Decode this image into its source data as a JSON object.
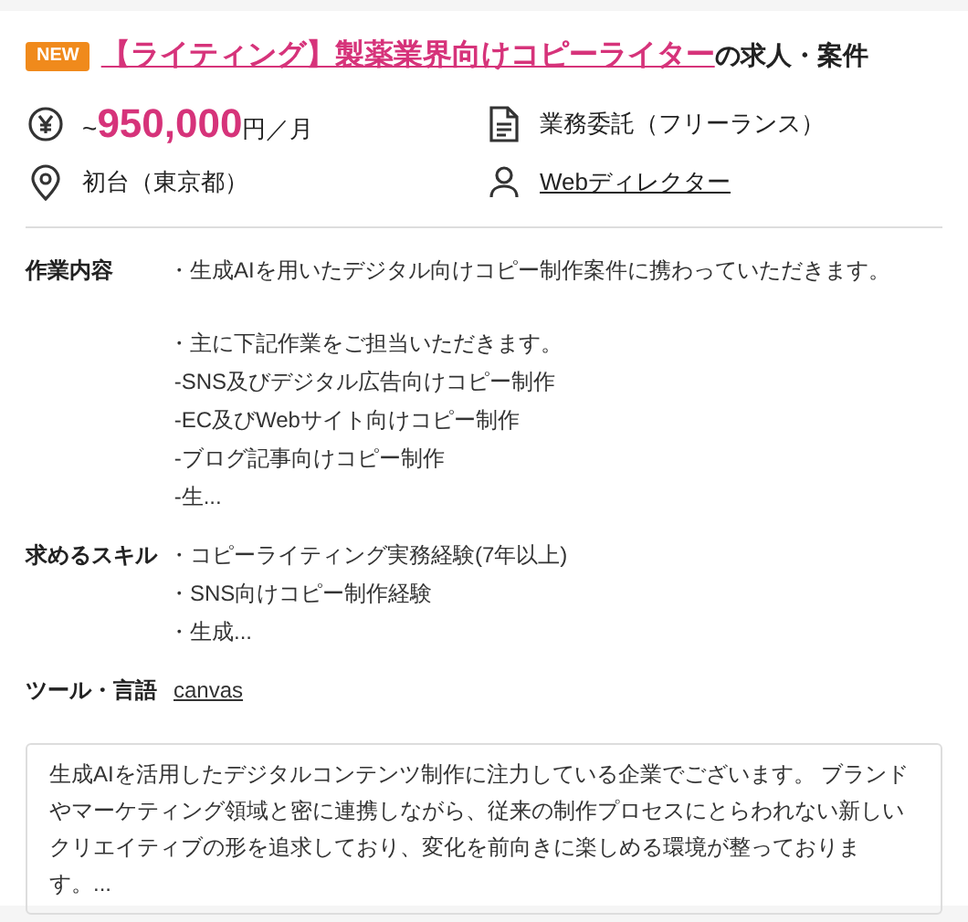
{
  "badge": "NEW",
  "title": {
    "link": "【ライティング】製薬業界向けコピーライター",
    "suffix": "の求人・案件"
  },
  "info": [
    {
      "kind": "salary",
      "prefix": "~",
      "amount": "950,000",
      "unit": "円／月"
    },
    {
      "kind": "contract",
      "text": "業務委託（フリーランス）"
    },
    {
      "kind": "location",
      "text": "初台（東京都）"
    },
    {
      "kind": "role",
      "text": "Webディレクター"
    }
  ],
  "sections": [
    {
      "label": "作業内容",
      "paragraphs": [
        [
          "・生成AIを用いたデジタル向けコピー制作案件に携わっていただきます。"
        ],
        [
          "・主に下記作業をご担当いただきます。",
          " -SNS及びデジタル広告向けコピー制作",
          " -EC及びWebサイト向けコピー制作",
          " -ブログ記事向けコピー制作",
          " -生..."
        ]
      ]
    },
    {
      "label": "求めるスキル",
      "paragraphs": [
        [
          "・コピーライティング実務経験(7年以上)",
          "・SNS向けコピー制作経験",
          "・生成..."
        ]
      ]
    },
    {
      "label": "ツール・言語",
      "tags": [
        "canvas"
      ]
    }
  ],
  "company": "生成AIを活用したデジタルコンテンツ制作に注力している企業でございます。 ブランドやマーケティング領域と密に連携しながら、従来の制作プロセスにとらわれない新しいクリエイティブの形を追求しており、変化を前向きに楽しめる環境が整っております。..."
}
